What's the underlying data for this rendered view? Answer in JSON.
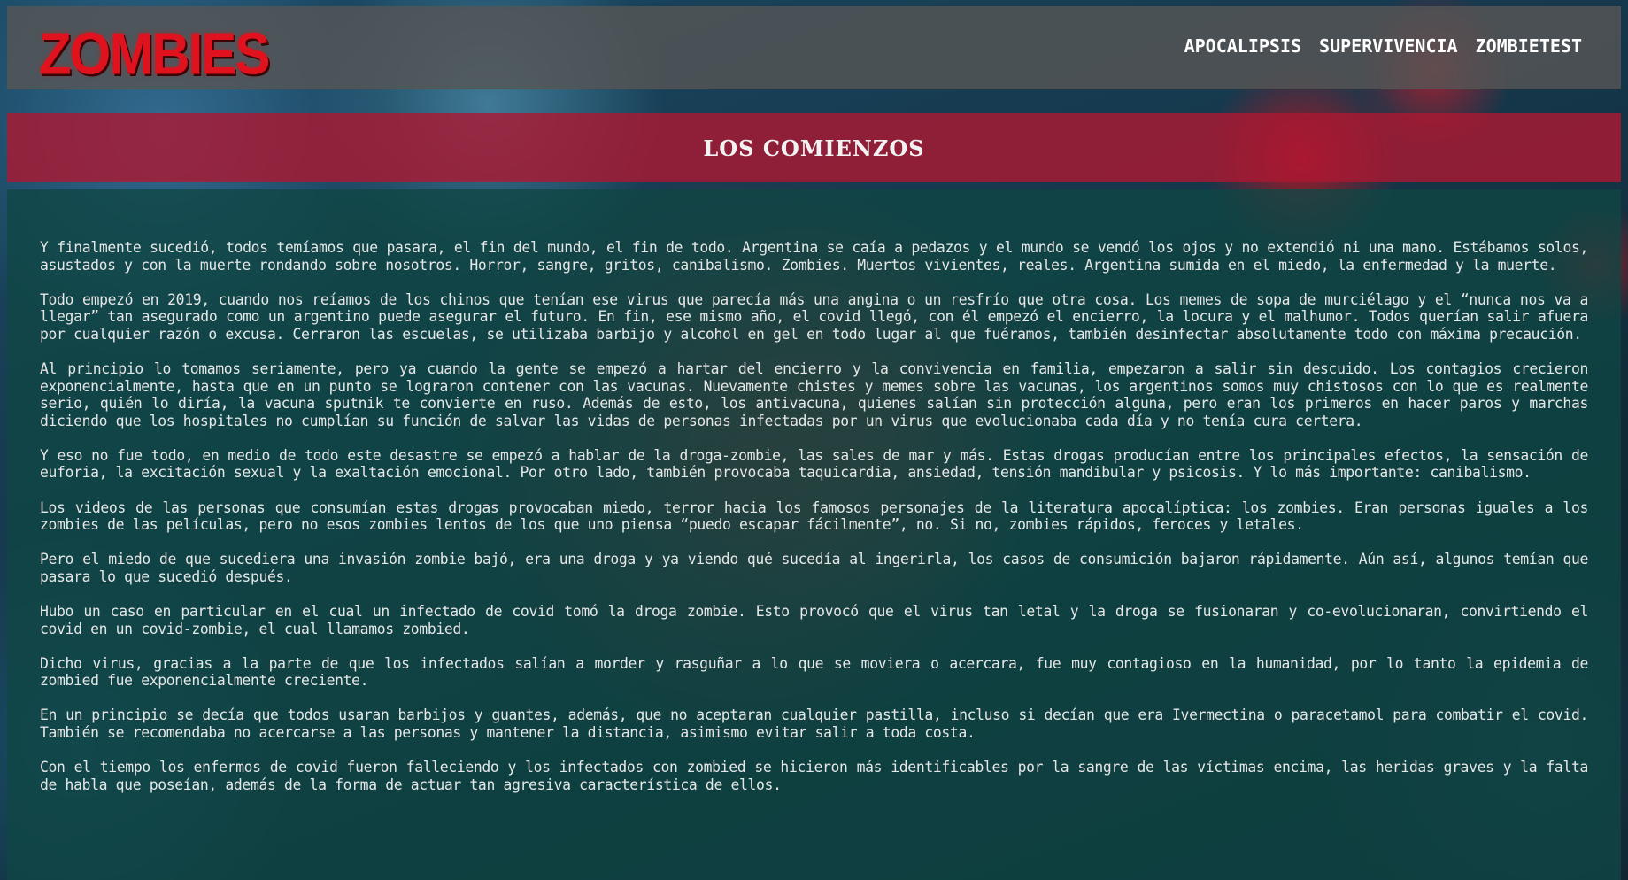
{
  "header": {
    "logo_text": "ZOMBIES",
    "nav": [
      {
        "label": "APOCALIPSIS"
      },
      {
        "label": "SUPERVIVENCIA"
      },
      {
        "label": "ZOMBIETEST"
      }
    ]
  },
  "banner": {
    "title": "LOS COMIENZOS"
  },
  "content": {
    "paragraphs": [
      "Y finalmente sucedió, todos temíamos que pasara, el fin del mundo, el fin de todo. Argentina se caía a pedazos y el mundo se vendó los ojos y no extendió ni una mano. Estábamos solos, asustados y con la muerte rondando sobre nosotros. Horror, sangre, gritos, canibalismo. Zombies. Muertos vivientes, reales. Argentina sumida en el miedo, la enfermedad y la muerte.",
      "Todo empezó en 2019, cuando nos reíamos de los chinos que tenían ese virus que parecía más una angina o un resfrío que otra cosa. Los memes de sopa de murciélago y el “nunca nos va a llegar” tan asegurado como un argentino puede asegurar el futuro. En fin, ese mismo año, el covid llegó, con él empezó el encierro, la locura y el malhumor. Todos querían salir afuera por cualquier razón o excusa. Cerraron las escuelas, se utilizaba barbijo y alcohol en gel en todo lugar al que fuéramos, también desinfectar absolutamente todo con máxima precaución.",
      "Al principio lo tomamos seriamente, pero ya cuando la gente se empezó a hartar del encierro y la convivencia en familia, empezaron a salir sin descuido. Los contagios crecieron exponencialmente, hasta que en un punto se lograron contener con las vacunas. Nuevamente chistes y memes sobre las vacunas, los argentinos somos muy chistosos con lo que es realmente serio, quién lo diría, la vacuna sputnik te convierte en ruso. Además de esto, los antivacuna, quienes salían sin protección alguna, pero eran los primeros en hacer paros y marchas diciendo que los hospitales no cumplían su función de salvar las vidas de personas infectadas por un virus que evolucionaba cada día y no tenía cura certera.",
      "Y eso no fue todo, en medio de todo este desastre se empezó a hablar de la droga-zombie, las sales de mar y más. Estas drogas producían entre los principales efectos, la sensación de euforia, la excitación sexual y la exaltación emocional. Por otro lado, también provocaba taquicardia, ansiedad, tensión mandibular y psicosis. Y lo más importante: canibalismo.",
      "Los videos de las personas que consumían estas drogas provocaban miedo, terror hacia los famosos personajes de la literatura apocalíptica: los zombies. Eran personas iguales a los zombies de las películas, pero no esos zombies lentos de los que uno piensa “puedo escapar fácilmente”, no. Si no, zombies rápidos, feroces y letales.",
      "Pero el miedo de que sucediera una invasión zombie bajó, era una droga y ya viendo qué sucedía al ingerirla, los casos de consumición bajaron rápidamente. Aún así, algunos temían que pasara lo que sucedió después.",
      "Hubo un caso en particular en el cual un infectado de covid tomó la droga zombie. Esto provocó que el virus tan letal y la droga se fusionaran y co-evolucionaran, convirtiendo el covid en un covid-zombie, el cual llamamos zombied.",
      "Dicho virus, gracias a la parte de que los infectados salían a morder y rasguñar a lo que se moviera o acercara, fue muy contagioso en la humanidad, por lo tanto la epidemia de zombied fue exponencialmente creciente.",
      "En un principio se decía que todos usaran barbijos y guantes, además, que no aceptaran cualquier pastilla, incluso si decían que era Ivermectina o paracetamol para combatir el covid. También se recomendaba no acercarse a las personas y mantener la distancia, asimismo evitar salir a toda costa.",
      "Con el tiempo los enfermos de covid fueron falleciendo y los infectados con zombied se hicieron más identificables por la sangre de las víctimas encima, las heridas graves y la falta de habla que poseían, además de la forma de actuar tan agresiva característica de ellos."
    ]
  }
}
